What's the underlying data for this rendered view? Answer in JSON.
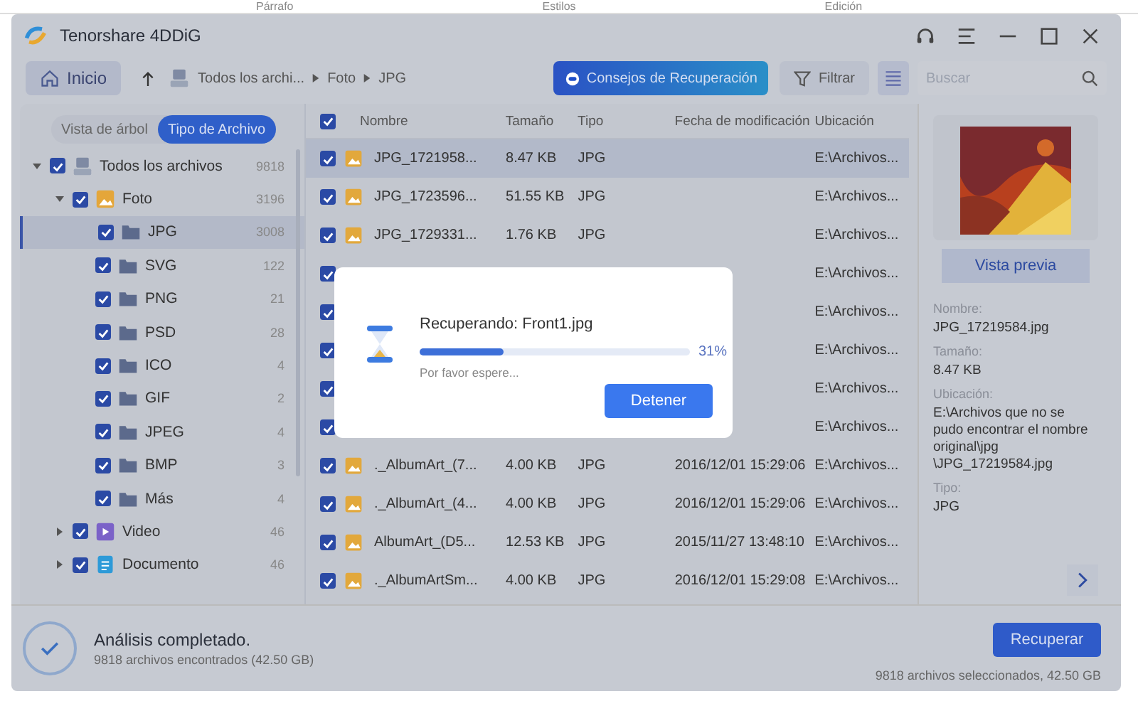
{
  "background_ribbon": [
    "Párrafo",
    "Estilos",
    "Edición"
  ],
  "window": {
    "title": "Tenorshare 4DDiG"
  },
  "toolbar": {
    "home": "Inicio",
    "breadcrumb": [
      "Todos los archi...",
      "Foto",
      "JPG"
    ],
    "tips_button": "Consejos de Recuperación",
    "filter_button": "Filtrar",
    "search": {
      "placeholder": "Buscar"
    }
  },
  "view_tabs": [
    {
      "label": "Vista de árbol",
      "selected": false
    },
    {
      "label": "Tipo de Archivo",
      "selected": true
    }
  ],
  "tree": [
    {
      "label": "Todos los archivos",
      "count": "9818",
      "kind": "all",
      "checked": true,
      "expanded": true,
      "selected": false,
      "children": [
        {
          "label": "Foto",
          "count": "3196",
          "checked": true,
          "expanded": true,
          "selected": false,
          "children": [
            {
              "label": "JPG",
              "count": "3008",
              "kind": "folder",
              "checked": true,
              "selected": true
            },
            {
              "label": "SVG",
              "count": "122",
              "kind": "folder",
              "checked": true,
              "selected": false
            },
            {
              "label": "PNG",
              "count": "21",
              "kind": "folder",
              "checked": true,
              "selected": false
            },
            {
              "label": "PSD",
              "count": "28",
              "kind": "folder",
              "checked": true,
              "selected": false
            },
            {
              "label": "ICO",
              "count": "4",
              "kind": "folder",
              "checked": true,
              "selected": false
            },
            {
              "label": "GIF",
              "count": "2",
              "kind": "folder",
              "checked": true,
              "selected": false
            },
            {
              "label": "JPEG",
              "count": "4",
              "kind": "folder",
              "checked": true,
              "selected": false
            },
            {
              "label": "BMP",
              "count": "3",
              "kind": "folder",
              "checked": true,
              "selected": false
            },
            {
              "label": "Más",
              "count": "4",
              "kind": "folder",
              "checked": true,
              "selected": false
            }
          ]
        },
        {
          "label": "Video",
          "count": "46",
          "kind": "video",
          "checked": true,
          "expanded": false,
          "selected": false
        },
        {
          "label": "Documento",
          "count": "46",
          "kind": "document",
          "checked": true,
          "expanded": false,
          "selected": false
        }
      ]
    }
  ],
  "table": {
    "all_checked": true,
    "columns": [
      "Nombre",
      "Tamaño",
      "Tipo",
      "Fecha de modificación",
      "Ubicación"
    ],
    "rows": [
      {
        "checked": true,
        "selected": true,
        "name": "JPG_1721958...",
        "size": "8.47 KB",
        "type": "JPG",
        "location": "E:\\Archivos..."
      },
      {
        "checked": true,
        "selected": false,
        "name": "JPG_1723596...",
        "size": "51.55 KB",
        "type": "JPG",
        "location": "E:\\Archivos..."
      },
      {
        "checked": true,
        "selected": false,
        "name": "JPG_1729331...",
        "size": "1.76 KB",
        "type": "JPG",
        "location": "E:\\Archivos..."
      },
      {
        "checked": true,
        "selected": false,
        "location": "E:\\Archivos..."
      },
      {
        "checked": true,
        "selected": false,
        "location": "E:\\Archivos..."
      },
      {
        "checked": true,
        "selected": false,
        "location": "E:\\Archivos..."
      },
      {
        "checked": true,
        "selected": false,
        "location": "E:\\Archivos..."
      },
      {
        "checked": true,
        "selected": false,
        "location": "E:\\Archivos..."
      },
      {
        "checked": true,
        "selected": false,
        "name": "._AlbumArt_(7...",
        "size": "4.00 KB",
        "type": "JPG",
        "date": "2016/12/01 15:29:06",
        "location": "E:\\Archivos..."
      },
      {
        "checked": true,
        "selected": false,
        "name": "._AlbumArt_(4...",
        "size": "4.00 KB",
        "type": "JPG",
        "date": "2016/12/01 15:29:06",
        "location": "E:\\Archivos..."
      },
      {
        "checked": true,
        "selected": false,
        "name": "AlbumArt_(D5...",
        "size": "12.53 KB",
        "type": "JPG",
        "date": "2015/11/27 13:48:10",
        "location": "E:\\Archivos..."
      },
      {
        "checked": true,
        "selected": false,
        "name": "._AlbumArtSm...",
        "size": "4.00 KB",
        "type": "JPG",
        "date": "2016/12/01 15:29:08",
        "location": "E:\\Archivos..."
      }
    ]
  },
  "details": {
    "preview_button": "Vista previa",
    "fields": [
      {
        "label": "Nombre:",
        "value": "JPG_17219584.jpg"
      },
      {
        "label": "Tamaño:",
        "value": "8.47 KB"
      },
      {
        "label": "Ubicación:",
        "value": "E:\\Archivos que no se pudo encontrar el nombre original\\jpg \\JPG_17219584.jpg"
      },
      {
        "label": "Tipo:",
        "value": "JPG"
      }
    ]
  },
  "status_bar": {
    "title": "Análisis completado.",
    "subtitle": "9818 archivos encontrados (42.50 GB)",
    "recover_button": "Recuperar",
    "selection": "9818 archivos seleccionados, 42.50 GB"
  },
  "dialog": {
    "title": "Recuperando: Front1.jpg",
    "level": 0.31,
    "percent": "31%",
    "message": "Por favor espere...",
    "stop_button": "Detener"
  }
}
